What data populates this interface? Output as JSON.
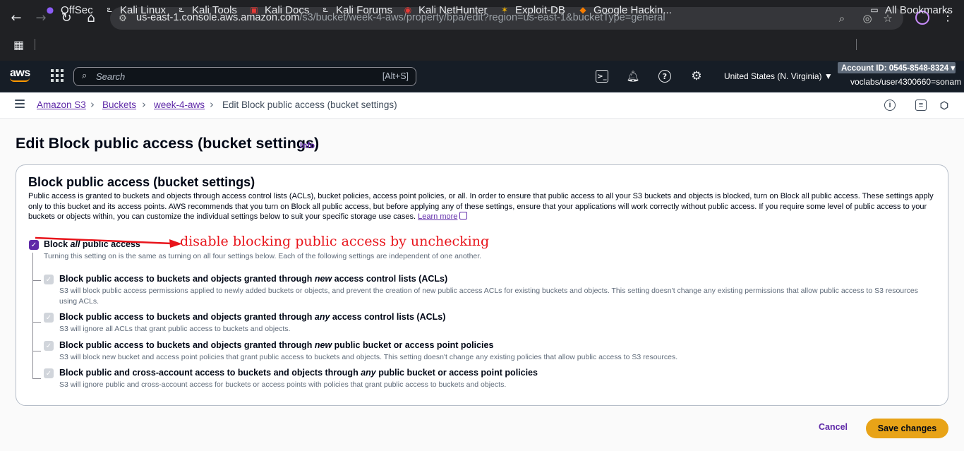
{
  "browser": {
    "url_host": "us-east-1.console.aws.amazon.com",
    "url_path": "/s3/bucket/week-4-aws/property/bpa/edit?region=us-east-1&bucketType=general",
    "bookmarks": [
      {
        "label": "OffSec"
      },
      {
        "label": "Kali Linux"
      },
      {
        "label": "Kali Tools"
      },
      {
        "label": "Kali Docs"
      },
      {
        "label": "Kali Forums"
      },
      {
        "label": "Kali NetHunter"
      },
      {
        "label": "Exploit-DB"
      },
      {
        "label": "Google Hackin..."
      }
    ],
    "all_bookmarks": "All Bookmarks"
  },
  "aws_nav": {
    "logo": "aws",
    "search_placeholder": "Search",
    "search_shortcut": "[Alt+S]",
    "region": "United States (N. Virginia) ▼",
    "account_id": "Account ID: 0545-8548-8324 ▾",
    "user": "voclabs/user4300660=sonam"
  },
  "breadcrumb": {
    "items": [
      "Amazon S3",
      "Buckets",
      "week-4-aws"
    ],
    "current": "Edit Block public access (bucket settings)"
  },
  "page": {
    "title": "Edit Block public access (bucket settings)",
    "info": "Info"
  },
  "panel": {
    "title": "Block public access (bucket settings)",
    "description": "Public access is granted to buckets and objects through access control lists (ACLs), bucket policies, access point policies, or all. In order to ensure that public access to all your S3 buckets and objects is blocked, turn on Block all public access. These settings apply only to this bucket and its access points. AWS recommends that you turn on Block all public access, but before applying any of these settings, ensure that your applications will work correctly without public access. If you require some level of public access to your buckets or objects within, you can customize the individual settings below to suit your specific storage use cases.",
    "learn_more": "Learn more",
    "block_all": {
      "label_pre": "Block ",
      "label_em": "all",
      "label_post": " public access",
      "checked": true,
      "desc": "Turning this setting on is the same as turning on all four settings below. Each of the following settings are independent of one another."
    },
    "options": [
      {
        "label_pre": "Block public access to buckets and objects granted through ",
        "label_em": "new",
        "label_post": " access control lists (ACLs)",
        "desc": "S3 will block public access permissions applied to newly added buckets or objects, and prevent the creation of new public access ACLs for existing buckets and objects. This setting doesn't change any existing permissions that allow public access to S3 resources using ACLs."
      },
      {
        "label_pre": "Block public access to buckets and objects granted through ",
        "label_em": "any",
        "label_post": " access control lists (ACLs)",
        "desc": "S3 will ignore all ACLs that grant public access to buckets and objects."
      },
      {
        "label_pre": "Block public access to buckets and objects granted through ",
        "label_em": "new",
        "label_post": " public bucket or access point policies",
        "desc": "S3 will block new bucket and access point policies that grant public access to buckets and objects. This setting doesn't change any existing policies that allow public access to S3 resources."
      },
      {
        "label_pre": "Block public and cross-account access to buckets and objects through ",
        "label_em": "any",
        "label_post": " public bucket or access point policies",
        "desc": "S3 will ignore public and cross-account access for buckets or access points with policies that grant public access to buckets and objects."
      }
    ]
  },
  "annotation": {
    "text": "disable blocking public access by unchecking",
    "color": "#e8141b"
  },
  "actions": {
    "cancel": "Cancel",
    "save": "Save changes"
  },
  "colors": {
    "accent": "#5f2aa8",
    "save_button": "#e8a317",
    "aws_nav_bg": "#161d26"
  }
}
